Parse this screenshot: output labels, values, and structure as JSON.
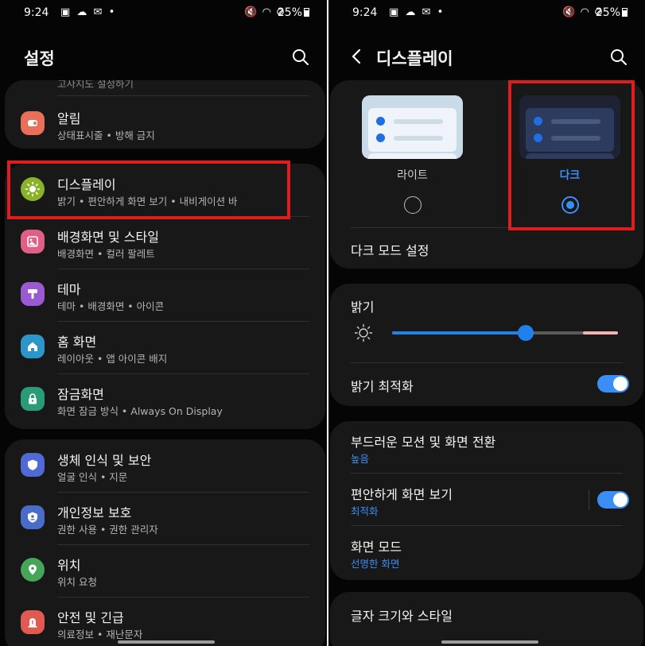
{
  "left": {
    "status": {
      "time": "9:24",
      "battery": "25%"
    },
    "title": "설정",
    "top_partial": "고사지도 설정하기",
    "group1": [
      {
        "label": "알림",
        "sub": "상태표시줄 • 방해 금지",
        "icon": "bell-icon",
        "color": "#e8705b"
      }
    ],
    "group2": [
      {
        "label": "디스플레이",
        "sub": "밝기 • 편안하게 화면 보기 • 내비게이션 바",
        "icon": "sun-icon",
        "color": "#8ab32a"
      },
      {
        "label": "배경화면 및 스타일",
        "sub": "배경화면 • 컬러 팔레트",
        "icon": "image-icon",
        "color": "#df5f86"
      },
      {
        "label": "테마",
        "sub": "테마 • 배경화면 • 아이콘",
        "icon": "brush-icon",
        "color": "#9b5ad1"
      },
      {
        "label": "홈 화면",
        "sub": "레이아웃 • 앱 아이콘 배지",
        "icon": "home-icon",
        "color": "#2a96c9"
      },
      {
        "label": "잠금화면",
        "sub": "화면 잠금 방식 • Always On Display",
        "icon": "lock-icon",
        "color": "#2a9a78"
      }
    ],
    "group3": [
      {
        "label": "생체 인식 및 보안",
        "sub": "얼굴 인식 • 지문",
        "icon": "shield-icon",
        "color": "#5069d4"
      },
      {
        "label": "개인정보 보호",
        "sub": "권한 사용 • 권한 관리자",
        "icon": "privacy-shield-icon",
        "color": "#4a6cc9"
      },
      {
        "label": "위치",
        "sub": "위치 요청",
        "icon": "location-pin-icon",
        "color": "#47a55a"
      },
      {
        "label": "안전 및 긴급",
        "sub": "의료정보 • 재난문자",
        "icon": "emergency-icon",
        "color": "#e05a52"
      }
    ]
  },
  "right": {
    "status": {
      "time": "9:24",
      "battery": "25%"
    },
    "title": "디스플레이",
    "mode": {
      "light_label": "라이트",
      "dark_label": "다크",
      "selected": "dark",
      "dark_settings": "다크 모드 설정"
    },
    "brightness": {
      "label": "밝기",
      "level_percent": 59,
      "adaptive_label": "밝기 최적화",
      "adaptive_on": true
    },
    "motion": {
      "label": "부드러운 모션 및 화면 전환",
      "value": "높음"
    },
    "eye_comfort": {
      "label": "편안하게 화면 보기",
      "value": "최적화",
      "on": true
    },
    "screen_mode": {
      "label": "화면 모드",
      "value": "선명한 화면"
    },
    "font": {
      "label": "글자 크기와 스타일"
    }
  },
  "colors": {
    "accent": "#3a8ef6",
    "highlight_box": "#e01c1c",
    "card": "#181818",
    "background": "#050505"
  }
}
